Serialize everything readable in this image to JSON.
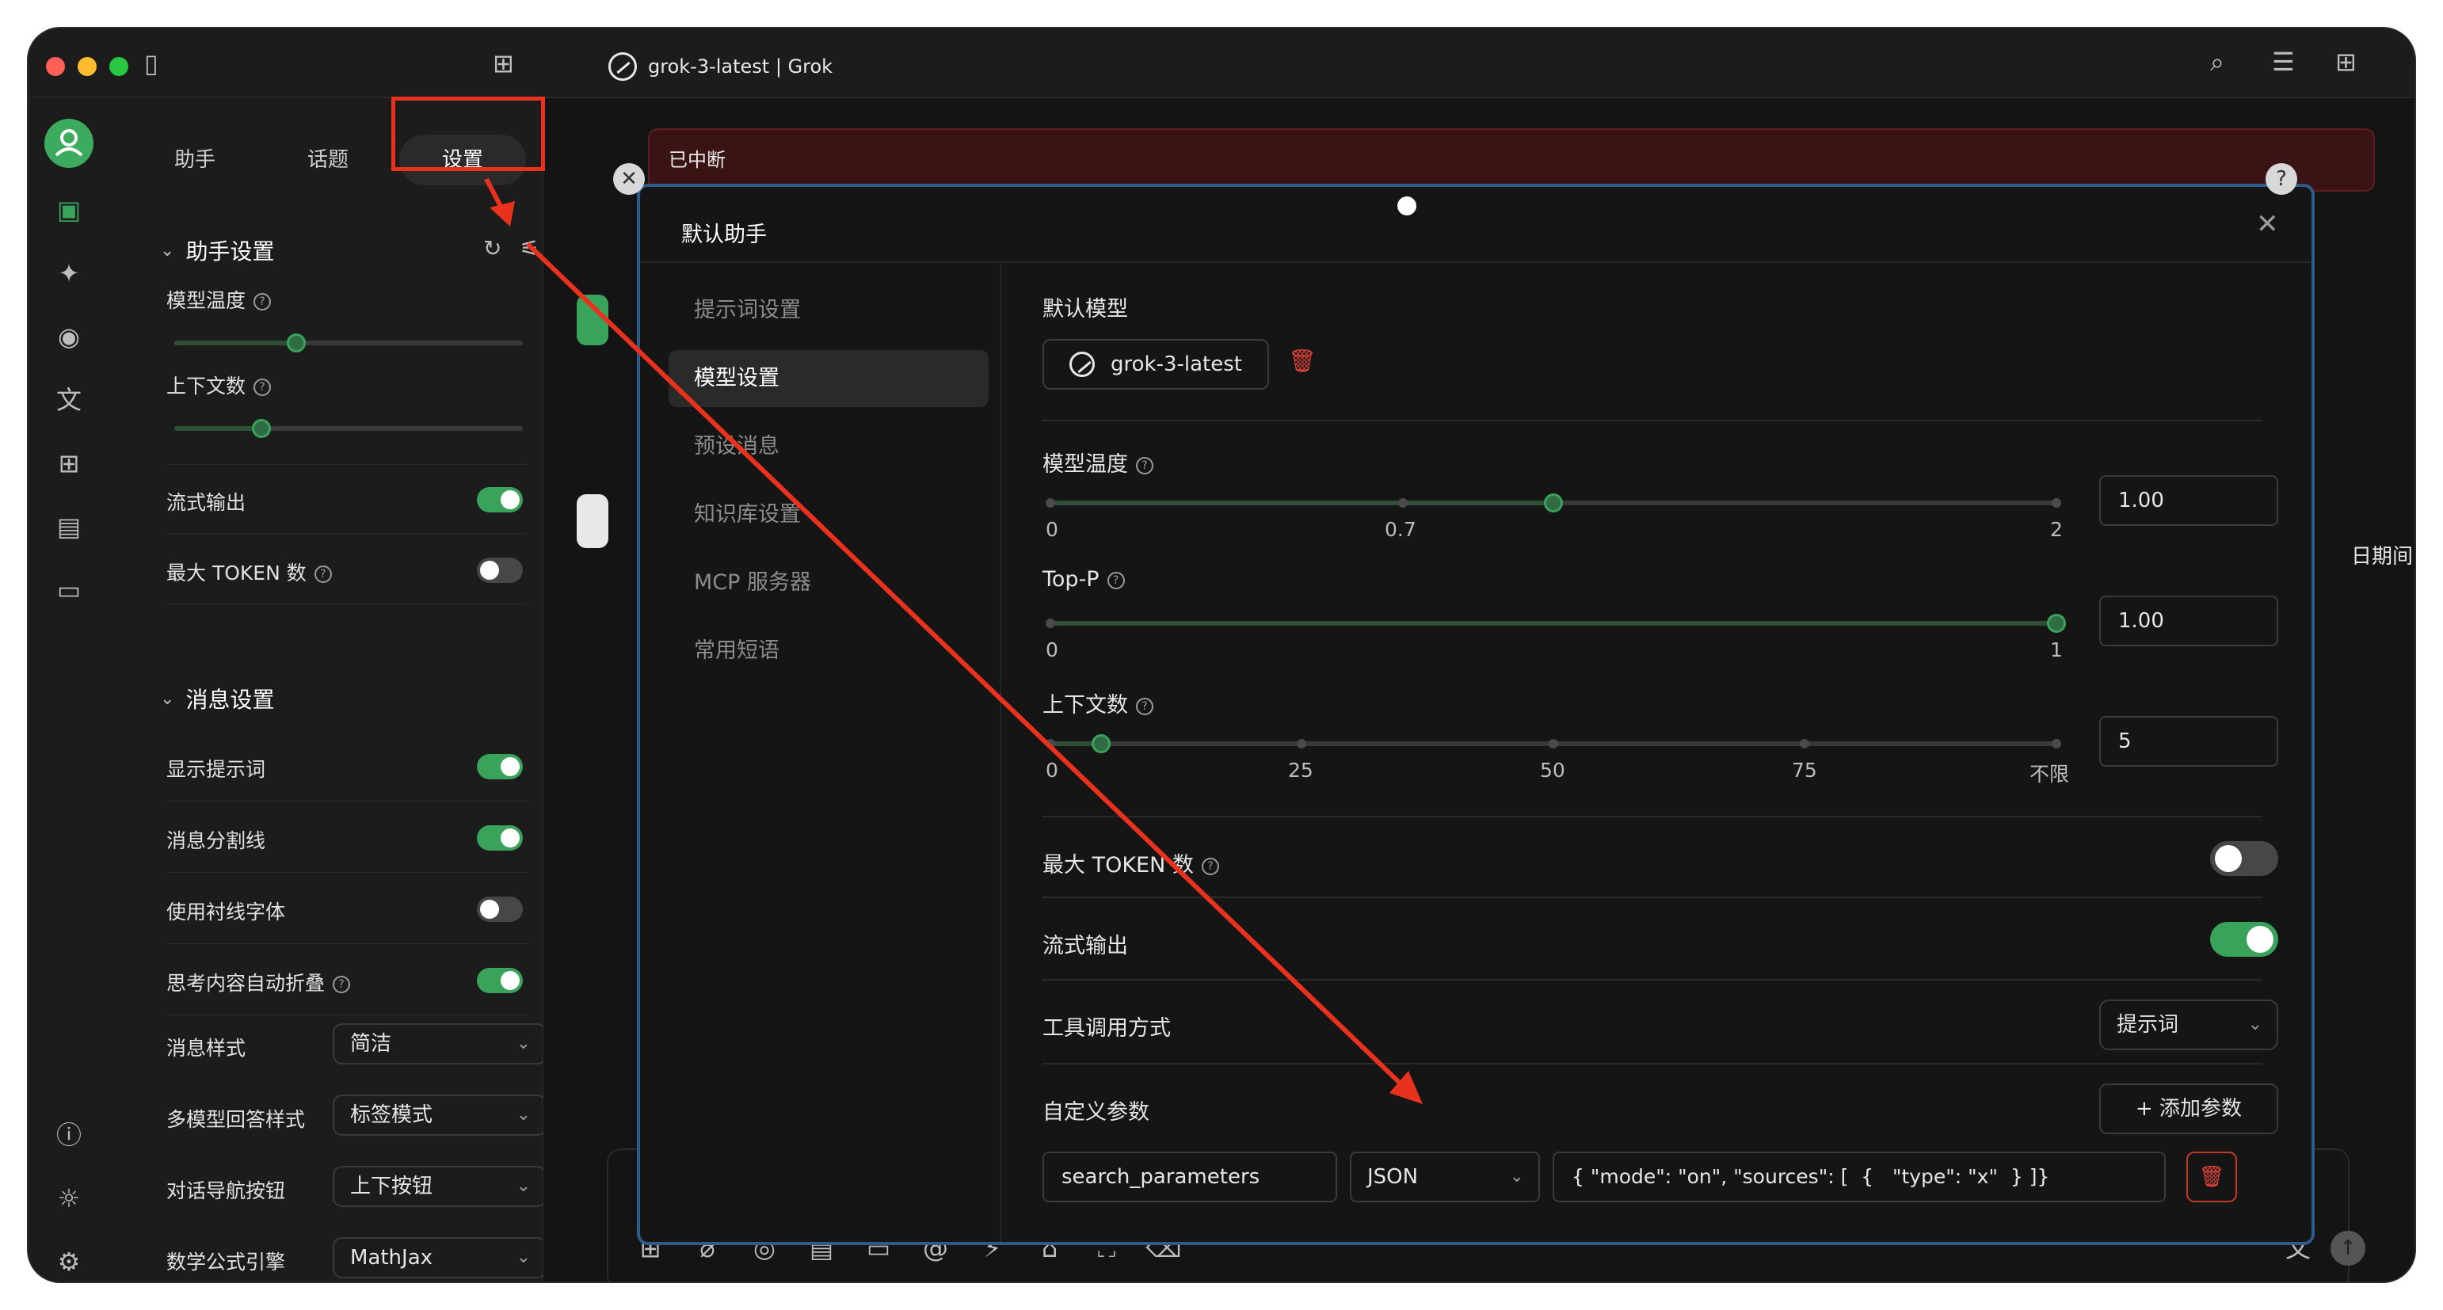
{
  "window": {
    "title": "grok-3-latest | Grok",
    "traffic_colors": [
      "#fe5f57",
      "#febc2e",
      "#28c840"
    ]
  },
  "icons": {
    "sidebar_toggle": "sidebar-toggle-icon",
    "new_window": "new-window-icon",
    "search": "search-icon",
    "layout": "layout-icon",
    "grid": "grid-icon"
  },
  "rail": {
    "items": [
      "chat-icon",
      "sparkle-icon",
      "palette-icon",
      "translate-icon",
      "apps-icon",
      "files-icon",
      "folder-icon"
    ],
    "bottom": [
      "help-icon",
      "theme-icon",
      "settings-icon"
    ]
  },
  "panel": {
    "tabs": [
      {
        "label": "助手"
      },
      {
        "label": "话题"
      },
      {
        "label": "设置"
      }
    ],
    "assistant_section": "助手设置",
    "model_temp_label": "模型温度",
    "model_temp_value": 0.7,
    "context_label": "上下文数",
    "context_value": 5,
    "stream_label": "流式输出",
    "stream_on": true,
    "max_token_label": "最大 TOKEN 数",
    "max_token_on": false,
    "message_section": "消息设置",
    "toggles": [
      {
        "label": "显示提示词",
        "on": true
      },
      {
        "label": "消息分割线",
        "on": true
      },
      {
        "label": "使用衬线字体",
        "on": false
      },
      {
        "label": "思考内容自动折叠",
        "on": true
      }
    ],
    "selects": [
      {
        "label": "消息样式",
        "value": "简洁"
      },
      {
        "label": "多模型回答样式",
        "value": "标签模式"
      },
      {
        "label": "对话导航按钮",
        "value": "上下按钮"
      },
      {
        "label": "数学公式引擎",
        "value": "MathJax"
      }
    ]
  },
  "main": {
    "banner": "已中断",
    "side_text": "日期间"
  },
  "dialog": {
    "title": "默认助手",
    "nav": [
      {
        "label": "提示词设置"
      },
      {
        "label": "模型设置"
      },
      {
        "label": "预设消息"
      },
      {
        "label": "知识库设置"
      },
      {
        "label": "MCP 服务器"
      },
      {
        "label": "常用短语"
      }
    ],
    "default_model_label": "默认模型",
    "default_model_value": "grok-3-latest",
    "temp_label": "模型温度",
    "temp_ticks": [
      "0",
      "0.7",
      "2"
    ],
    "temp_value": "1.00",
    "top_p_label": "Top-P",
    "top_p_ticks": [
      "0",
      "1"
    ],
    "top_p_value": "1.00",
    "context_label": "上下文数",
    "context_ticks": [
      "0",
      "25",
      "50",
      "75",
      "不限"
    ],
    "context_value": "5",
    "max_token_label": "最大 TOKEN 数",
    "max_token_on": false,
    "stream_label": "流式输出",
    "stream_on": true,
    "tool_call_label": "工具调用方式",
    "tool_call_value": "提示词",
    "custom_params_label": "自定义参数",
    "add_param_label": "添加参数",
    "param_name": "search_parameters",
    "param_type": "JSON",
    "param_value": "{ \"mode\": \"on\", \"sources\": [  {   \"type\": \"x\"  } ]}"
  },
  "annotation_color": "#e8321e"
}
